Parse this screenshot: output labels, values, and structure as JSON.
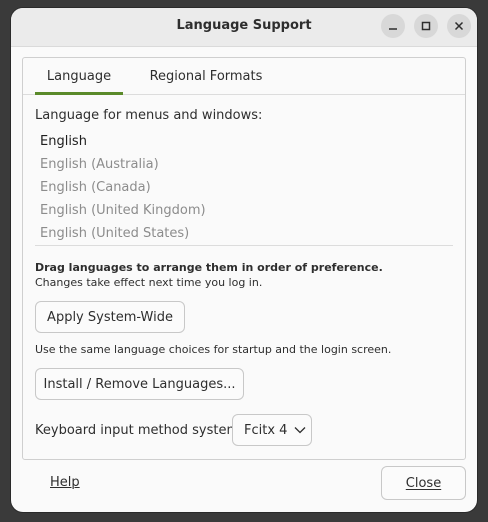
{
  "window": {
    "title": "Language Support"
  },
  "tabs": [
    {
      "label": "Language",
      "active": true
    },
    {
      "label": "Regional Formats",
      "active": false
    }
  ],
  "language": {
    "section_label": "Language for menus and windows:",
    "items": [
      {
        "label": "English",
        "primary": true
      },
      {
        "label": "English (Australia)",
        "primary": false
      },
      {
        "label": "English (Canada)",
        "primary": false
      },
      {
        "label": "English (United Kingdom)",
        "primary": false
      },
      {
        "label": "English (United States)",
        "primary": false
      }
    ],
    "drag_hint": "Drag languages to arrange them in order of preference.",
    "effect_note": "Changes take effect next time you log in.",
    "apply_button": "Apply System-Wide",
    "apply_note": "Use the same language choices for startup and the login screen.",
    "install_button": "Install / Remove Languages...",
    "keyboard_label": "Keyboard input method system:",
    "keyboard_value": "Fcitx 4"
  },
  "footer": {
    "help": "Help",
    "close": "Close"
  },
  "colors": {
    "accent": "#5a8a2a",
    "secondary_text": "#8c8c8c"
  }
}
